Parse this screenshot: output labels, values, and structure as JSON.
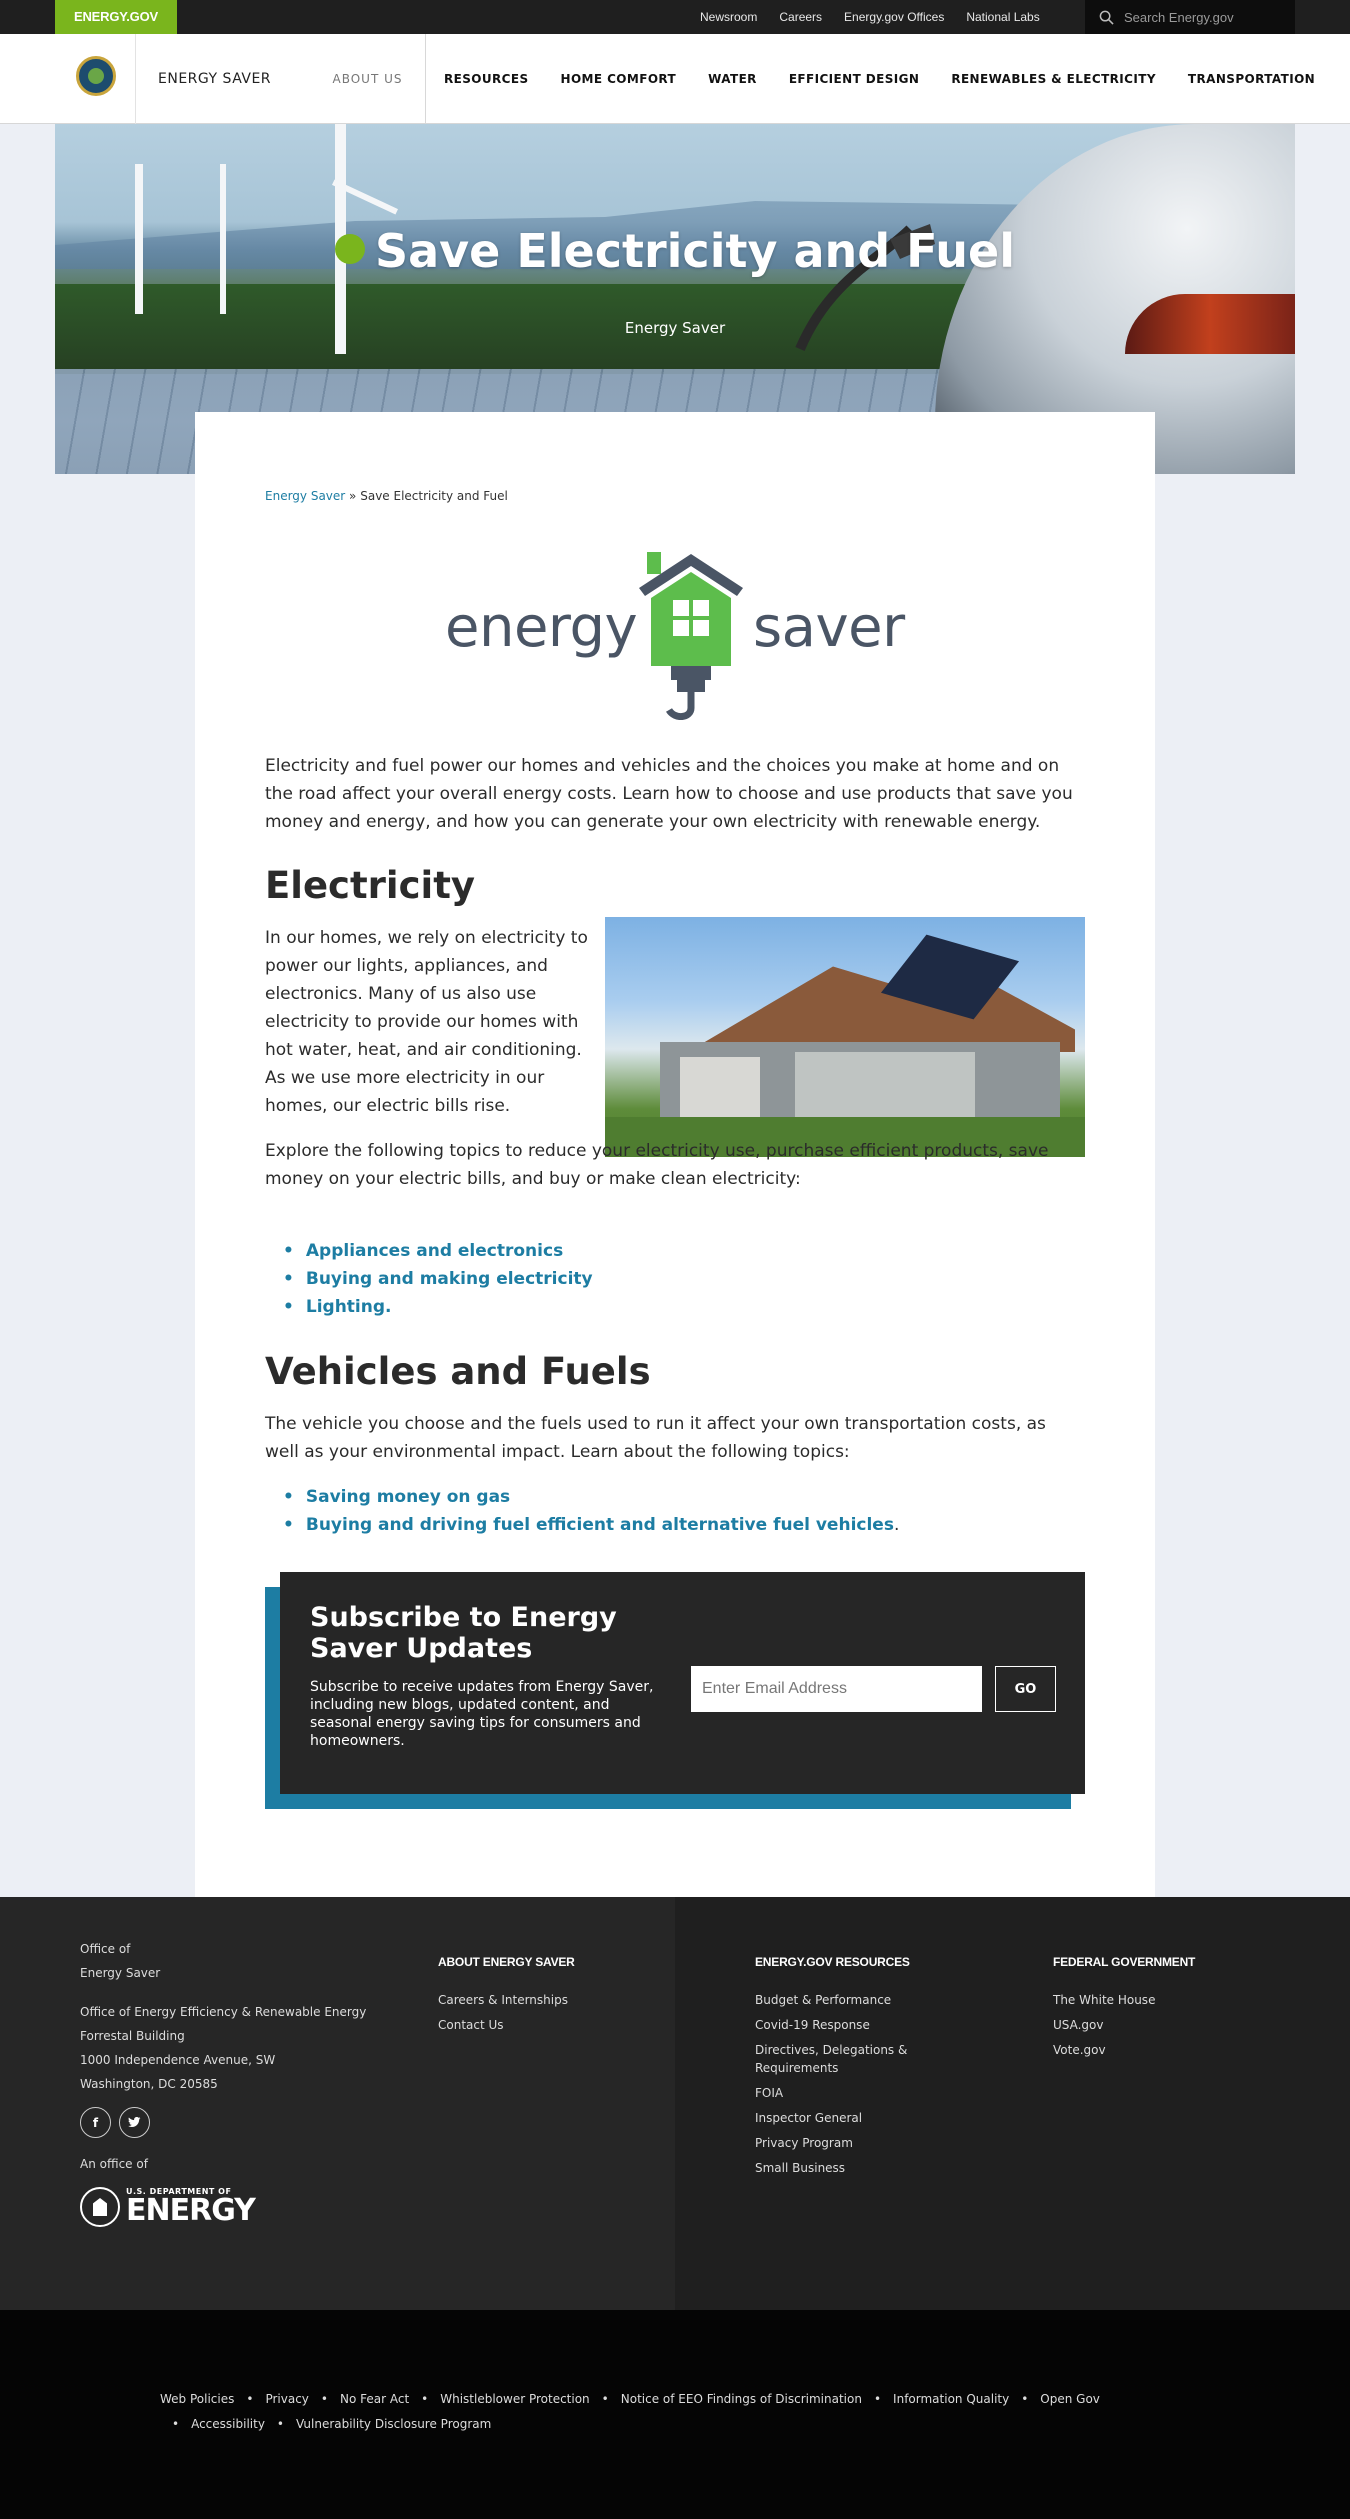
{
  "utility": {
    "gov_label": "ENERGY.GOV",
    "links": [
      "Newsroom",
      "Careers",
      "Energy.gov Offices",
      "National Labs"
    ],
    "search_placeholder": "Search Energy.gov"
  },
  "nav": {
    "site_name": "ENERGY SAVER",
    "about": "ABOUT US",
    "items": [
      "RESOURCES",
      "HOME COMFORT",
      "WATER",
      "EFFICIENT DESIGN",
      "RENEWABLES & ELECTRICITY",
      "TRANSPORTATION"
    ]
  },
  "hero": {
    "title": "Save Electricity and Fuel",
    "subtitle": "Energy Saver"
  },
  "breadcrumb": {
    "home": "Energy Saver",
    "separator": "»",
    "current": "Save Electricity and Fuel"
  },
  "logo": {
    "word1": "energy",
    "word2": "saver",
    "green": "#5dbd4c",
    "gray": "#4a5565"
  },
  "content": {
    "intro": "Electricity and fuel power our homes and vehicles and the choices you make at home and on the road affect your overall energy costs. Learn how to choose and use products that save you money and energy, and how you can generate your own electricity with renewable energy.",
    "electricity_heading": "Electricity",
    "electricity_p1": "In our homes, we rely on electricity to power our lights, appliances, and electronics. Many of us also use electricity to provide our homes with hot water, heat, and air conditioning. As we use more electricity in our homes, our electric bills rise.",
    "electricity_p2": "Explore the following topics to reduce your electricity use, purchase efficient products, save money on your electric bills, and buy or make clean electricity:",
    "electricity_links": [
      "Appliances and electronics",
      "Buying and making electricity",
      "Lighting"
    ],
    "electricity_links_tail": ".",
    "vehicles_heading": "Vehicles and Fuels",
    "vehicles_p": "The vehicle you choose and the fuels used to run it affect your own transportation costs, as well as your environmental impact. Learn about the following topics:",
    "vehicles_links": [
      "Saving money on gas",
      "Buying and driving fuel efficient and alternative fuel vehicles"
    ],
    "vehicles_links_tail": "."
  },
  "subscribe": {
    "title": "Subscribe to Energy Saver Updates",
    "description": "Subscribe to receive updates from Energy Saver, including new blogs, updated content, and seasonal energy saving tips for consumers and homeowners.",
    "email_placeholder": "Enter Email Address",
    "button": "GO",
    "accent": "#1d7da3"
  },
  "footer": {
    "office_line1": "Office of",
    "office_line2": "Energy Saver",
    "address": [
      "Office of Energy Efficiency & Renewable Energy",
      "Forrestal Building",
      "1000 Independence Avenue, SW",
      "Washington, DC 20585"
    ],
    "social": [
      "facebook-icon",
      "twitter-icon"
    ],
    "an_office_of": "An office of",
    "doe_small": "U.S. DEPARTMENT OF",
    "doe_big": "ENERGY",
    "col1": {
      "heading": "ABOUT ENERGY SAVER",
      "links": [
        "Careers & Internships",
        "Contact Us"
      ]
    },
    "col2": {
      "heading": "ENERGY.GOV RESOURCES",
      "links": [
        "Budget & Performance",
        "Covid-19 Response",
        "Directives, Delegations & Requirements",
        "FOIA",
        "Inspector General",
        "Privacy Program",
        "Small Business"
      ]
    },
    "col3": {
      "heading": "FEDERAL GOVERNMENT",
      "links": [
        "The White House",
        "USA.gov",
        "Vote.gov"
      ]
    }
  },
  "bottom_links": [
    "Web Policies",
    "Privacy",
    "No Fear Act",
    "Whistleblower Protection",
    "Notice of EEO Findings of Discrimination",
    "Information Quality",
    "Open Gov",
    "Accessibility",
    "Vulnerability Disclosure Program"
  ]
}
